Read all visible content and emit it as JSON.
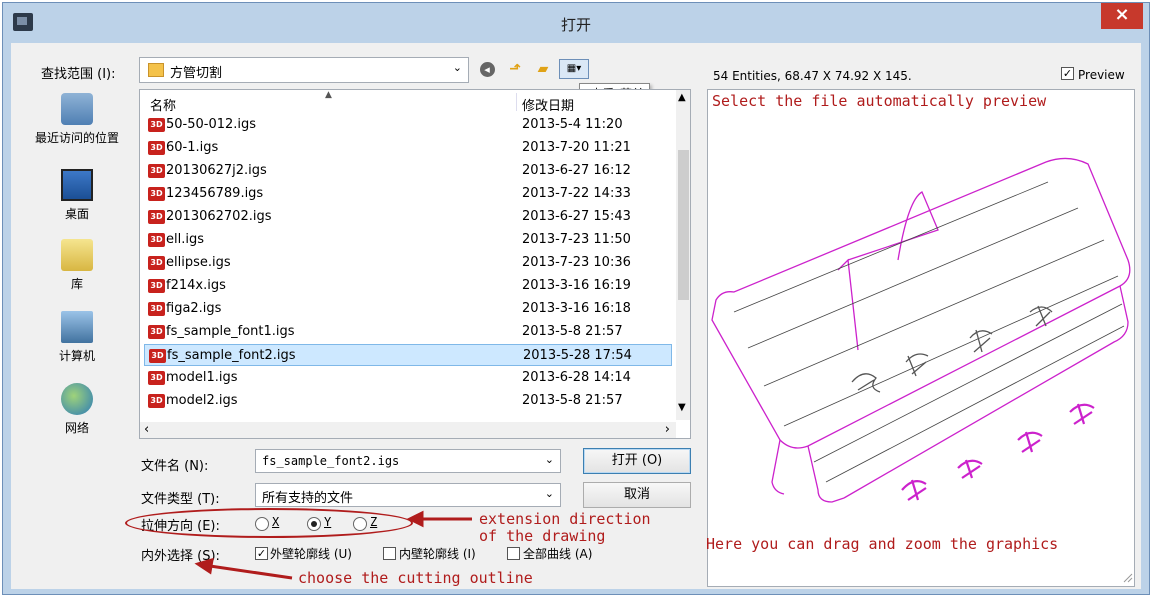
{
  "window": {
    "title": "打开",
    "close_label": "×"
  },
  "lookin": {
    "label": "查找范围 (I):",
    "value": "方管切割",
    "tooltip": "\"查看\"菜单"
  },
  "places": [
    {
      "label": "最近访问的位置",
      "icon": "recent-places-icon"
    },
    {
      "label": "桌面",
      "icon": "desktop-icon"
    },
    {
      "label": "库",
      "icon": "libraries-icon"
    },
    {
      "label": "计算机",
      "icon": "computer-icon"
    },
    {
      "label": "网络",
      "icon": "network-icon"
    }
  ],
  "list": {
    "col_name": "名称",
    "col_date": "修改日期",
    "files": [
      {
        "name": "50-50-012.igs",
        "date": "2013-5-4 11:20"
      },
      {
        "name": "60-1.igs",
        "date": "2013-7-20 11:21"
      },
      {
        "name": "20130627j2.igs",
        "date": "2013-6-27 16:12"
      },
      {
        "name": "123456789.igs",
        "date": "2013-7-22 14:33"
      },
      {
        "name": "2013062702.igs",
        "date": "2013-6-27 15:43"
      },
      {
        "name": "ell.igs",
        "date": "2013-7-23 11:50"
      },
      {
        "name": "ellipse.igs",
        "date": "2013-7-23 10:36"
      },
      {
        "name": "f214x.igs",
        "date": "2013-3-16 16:19"
      },
      {
        "name": "figa2.igs",
        "date": "2013-3-16 16:18"
      },
      {
        "name": "fs_sample_font1.igs",
        "date": "2013-5-8 21:57"
      },
      {
        "name": "fs_sample_font2.igs",
        "date": "2013-5-28 17:54"
      },
      {
        "name": "model1.igs",
        "date": "2013-6-28 14:14"
      },
      {
        "name": "model2.igs",
        "date": "2013-5-8 21:57"
      }
    ],
    "selected_index": 10
  },
  "filename": {
    "label": "文件名 (N):",
    "value": "fs_sample_font2.igs"
  },
  "filetype": {
    "label": "文件类型 (T):",
    "value": "所有支持的文件"
  },
  "buttons": {
    "open": "打开 (O)",
    "cancel": "取消"
  },
  "direction": {
    "label": "拉伸方向 (E):",
    "options": [
      "X",
      "Y",
      "Z"
    ],
    "selected": "Y"
  },
  "inout": {
    "label": "内外选择 (S):",
    "options": [
      {
        "label": "外壁轮廓线 (U)",
        "checked": true
      },
      {
        "label": "内壁轮廓线 (I)",
        "checked": false
      },
      {
        "label": "全部曲线 (A)",
        "checked": false
      }
    ]
  },
  "preview": {
    "info": "54 Entities, 68.47 X 74.92 X 145.",
    "checkbox_label": "Preview",
    "checked": true
  },
  "annotations": {
    "preview_note": "Select the file automatically preview",
    "extension_note": "extension direction\nof the drawing",
    "outline_note": "choose the cutting outline",
    "drag_note": "Here you can drag and zoom the graphics"
  },
  "colors": {
    "annotation": "#b01c1c",
    "model": "#cc22cc",
    "selection": "#cde8ff"
  }
}
